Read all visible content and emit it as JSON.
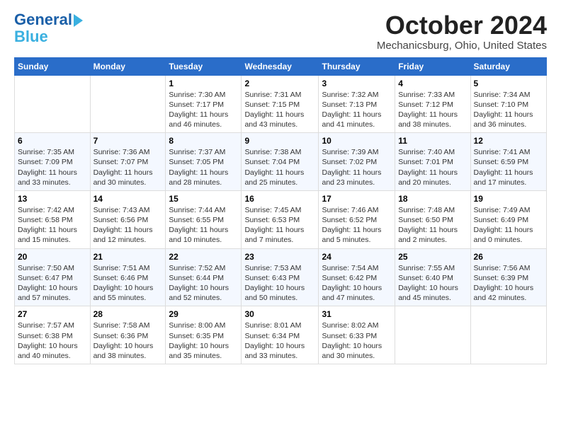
{
  "logo": {
    "line1": "General",
    "line2": "Blue"
  },
  "title": "October 2024",
  "location": "Mechanicsburg, Ohio, United States",
  "weekdays": [
    "Sunday",
    "Monday",
    "Tuesday",
    "Wednesday",
    "Thursday",
    "Friday",
    "Saturday"
  ],
  "weeks": [
    [
      {
        "day": "",
        "info": ""
      },
      {
        "day": "",
        "info": ""
      },
      {
        "day": "1",
        "info": "Sunrise: 7:30 AM\nSunset: 7:17 PM\nDaylight: 11 hours and 46 minutes."
      },
      {
        "day": "2",
        "info": "Sunrise: 7:31 AM\nSunset: 7:15 PM\nDaylight: 11 hours and 43 minutes."
      },
      {
        "day": "3",
        "info": "Sunrise: 7:32 AM\nSunset: 7:13 PM\nDaylight: 11 hours and 41 minutes."
      },
      {
        "day": "4",
        "info": "Sunrise: 7:33 AM\nSunset: 7:12 PM\nDaylight: 11 hours and 38 minutes."
      },
      {
        "day": "5",
        "info": "Sunrise: 7:34 AM\nSunset: 7:10 PM\nDaylight: 11 hours and 36 minutes."
      }
    ],
    [
      {
        "day": "6",
        "info": "Sunrise: 7:35 AM\nSunset: 7:09 PM\nDaylight: 11 hours and 33 minutes."
      },
      {
        "day": "7",
        "info": "Sunrise: 7:36 AM\nSunset: 7:07 PM\nDaylight: 11 hours and 30 minutes."
      },
      {
        "day": "8",
        "info": "Sunrise: 7:37 AM\nSunset: 7:05 PM\nDaylight: 11 hours and 28 minutes."
      },
      {
        "day": "9",
        "info": "Sunrise: 7:38 AM\nSunset: 7:04 PM\nDaylight: 11 hours and 25 minutes."
      },
      {
        "day": "10",
        "info": "Sunrise: 7:39 AM\nSunset: 7:02 PM\nDaylight: 11 hours and 23 minutes."
      },
      {
        "day": "11",
        "info": "Sunrise: 7:40 AM\nSunset: 7:01 PM\nDaylight: 11 hours and 20 minutes."
      },
      {
        "day": "12",
        "info": "Sunrise: 7:41 AM\nSunset: 6:59 PM\nDaylight: 11 hours and 17 minutes."
      }
    ],
    [
      {
        "day": "13",
        "info": "Sunrise: 7:42 AM\nSunset: 6:58 PM\nDaylight: 11 hours and 15 minutes."
      },
      {
        "day": "14",
        "info": "Sunrise: 7:43 AM\nSunset: 6:56 PM\nDaylight: 11 hours and 12 minutes."
      },
      {
        "day": "15",
        "info": "Sunrise: 7:44 AM\nSunset: 6:55 PM\nDaylight: 11 hours and 10 minutes."
      },
      {
        "day": "16",
        "info": "Sunrise: 7:45 AM\nSunset: 6:53 PM\nDaylight: 11 hours and 7 minutes."
      },
      {
        "day": "17",
        "info": "Sunrise: 7:46 AM\nSunset: 6:52 PM\nDaylight: 11 hours and 5 minutes."
      },
      {
        "day": "18",
        "info": "Sunrise: 7:48 AM\nSunset: 6:50 PM\nDaylight: 11 hours and 2 minutes."
      },
      {
        "day": "19",
        "info": "Sunrise: 7:49 AM\nSunset: 6:49 PM\nDaylight: 11 hours and 0 minutes."
      }
    ],
    [
      {
        "day": "20",
        "info": "Sunrise: 7:50 AM\nSunset: 6:47 PM\nDaylight: 10 hours and 57 minutes."
      },
      {
        "day": "21",
        "info": "Sunrise: 7:51 AM\nSunset: 6:46 PM\nDaylight: 10 hours and 55 minutes."
      },
      {
        "day": "22",
        "info": "Sunrise: 7:52 AM\nSunset: 6:44 PM\nDaylight: 10 hours and 52 minutes."
      },
      {
        "day": "23",
        "info": "Sunrise: 7:53 AM\nSunset: 6:43 PM\nDaylight: 10 hours and 50 minutes."
      },
      {
        "day": "24",
        "info": "Sunrise: 7:54 AM\nSunset: 6:42 PM\nDaylight: 10 hours and 47 minutes."
      },
      {
        "day": "25",
        "info": "Sunrise: 7:55 AM\nSunset: 6:40 PM\nDaylight: 10 hours and 45 minutes."
      },
      {
        "day": "26",
        "info": "Sunrise: 7:56 AM\nSunset: 6:39 PM\nDaylight: 10 hours and 42 minutes."
      }
    ],
    [
      {
        "day": "27",
        "info": "Sunrise: 7:57 AM\nSunset: 6:38 PM\nDaylight: 10 hours and 40 minutes."
      },
      {
        "day": "28",
        "info": "Sunrise: 7:58 AM\nSunset: 6:36 PM\nDaylight: 10 hours and 38 minutes."
      },
      {
        "day": "29",
        "info": "Sunrise: 8:00 AM\nSunset: 6:35 PM\nDaylight: 10 hours and 35 minutes."
      },
      {
        "day": "30",
        "info": "Sunrise: 8:01 AM\nSunset: 6:34 PM\nDaylight: 10 hours and 33 minutes."
      },
      {
        "day": "31",
        "info": "Sunrise: 8:02 AM\nSunset: 6:33 PM\nDaylight: 10 hours and 30 minutes."
      },
      {
        "day": "",
        "info": ""
      },
      {
        "day": "",
        "info": ""
      }
    ]
  ]
}
